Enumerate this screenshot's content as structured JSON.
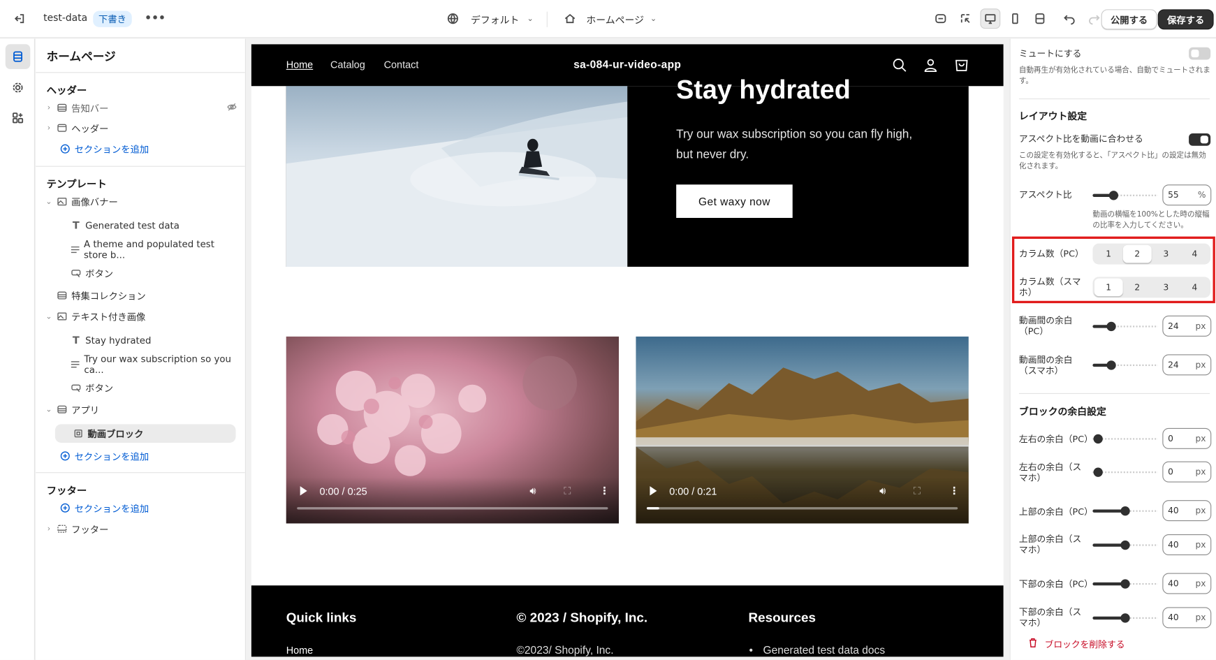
{
  "topbar": {
    "store_name": "test-data",
    "status_badge": "下書き",
    "theme_select": "デフォルト",
    "page_select": "ホームページ",
    "publish_label": "公開する",
    "save_label": "保存する"
  },
  "sidebar": {
    "title": "ホームページ",
    "header_group": "ヘッダー",
    "header_items": [
      "告知バー",
      "ヘッダー"
    ],
    "add_section": "セクションを追加",
    "template_group": "テンプレート",
    "template_items": [
      {
        "label": "画像バナー",
        "level": 1
      },
      {
        "label": "Generated test data",
        "level": 2
      },
      {
        "label": "A theme and populated test store b...",
        "level": 2
      },
      {
        "label": "ボタン",
        "level": 2
      },
      {
        "label": "特集コレクション",
        "level": 1
      },
      {
        "label": "テキスト付き画像",
        "level": 1
      },
      {
        "label": "Stay hydrated",
        "level": 2
      },
      {
        "label": "Try our wax subscription so you ca...",
        "level": 2
      },
      {
        "label": "ボタン",
        "level": 2
      },
      {
        "label": "アプリ",
        "level": 1
      },
      {
        "label": "動画ブロック",
        "level": 2
      }
    ],
    "footer_group": "フッター",
    "footer_items": [
      "フッター"
    ]
  },
  "preview": {
    "nav": [
      "Home",
      "Catalog",
      "Contact"
    ],
    "store_title": "sa-084-ur-video-app",
    "hero_heading": "Stay hydrated",
    "hero_text": "Try our wax subscription so you can fly high, but never dry.",
    "hero_button": "Get waxy now",
    "videos": [
      {
        "time": "0:00 / 0:25",
        "progress": 0
      },
      {
        "time": "0:00 / 0:21",
        "progress": 0.04
      }
    ],
    "footer": {
      "col1_heading": "Quick links",
      "col1_link": "Home",
      "col2_heading": "© 2023 / Shopify, Inc.",
      "col2_text": "©2023/ Shopify, Inc.",
      "col3_heading": "Resources",
      "col3_link": "Generated test data docs"
    }
  },
  "settings": {
    "mute_label": "ミュートにする",
    "mute_on": false,
    "mute_hint": "自動再生が有効化されている場合、自動でミュートされます。",
    "layout_heading": "レイアウト設定",
    "fit_label": "アスペクト比を動画に合わせる",
    "fit_on": true,
    "fit_hint": "この設定を有効化すると、「アスペクト比」の設定は無効化されます。",
    "aspect_label": "アスペクト比",
    "aspect_value": "55",
    "aspect_unit": "%",
    "aspect_hint": "動画の横幅を100%とした時の縦幅の比率を入力してください。",
    "cols_pc_label": "カラム数（PC）",
    "cols_sp_label": "カラム数（スマホ）",
    "col_options": [
      "1",
      "2",
      "3",
      "4"
    ],
    "cols_pc_selected": 2,
    "cols_sp_selected": 1,
    "gap_pc_label": "動画間の余白（PC）",
    "gap_pc_value": "24",
    "gap_sp_label": "動画間の余白（スマホ）",
    "gap_sp_value": "24",
    "px_unit": "px",
    "block_heading": "ブロックの余白設定",
    "lr_pc_label": "左右の余白（PC）",
    "lr_pc_value": "0",
    "lr_sp_label": "左右の余白（スマホ）",
    "lr_sp_value": "0",
    "top_pc_label": "上部の余白（PC）",
    "top_pc_value": "40",
    "top_sp_label": "上部の余白（スマホ）",
    "top_sp_value": "40",
    "bot_pc_label": "下部の余白（PC）",
    "bot_pc_value": "40",
    "bot_sp_label": "下部の余白（スマホ）",
    "bot_sp_value": "40",
    "delete_label": "ブロックを削除する"
  },
  "colors": {
    "accent": "#005bd3",
    "danger": "#c70a24",
    "highlight": "#e11b1b",
    "primary": "#303030"
  }
}
